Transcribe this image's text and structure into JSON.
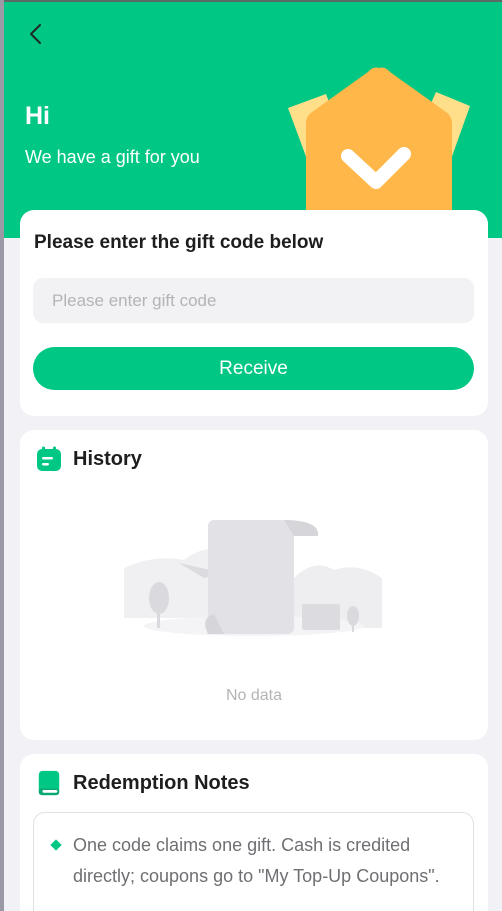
{
  "header": {
    "back_icon": "chevron-left-icon",
    "greeting": "Hi",
    "subtitle": "We have a gift for you",
    "illustration": "crown-badge-check"
  },
  "gift_card": {
    "title": "Please enter the gift code below",
    "input_placeholder": "Please enter gift code",
    "input_value": "",
    "receive_label": "Receive"
  },
  "history": {
    "icon": "calendar-list-icon",
    "title": "History",
    "empty_illustration": "empty-scroll",
    "empty_text": "No data"
  },
  "notes": {
    "icon": "book-icon",
    "title": "Redemption Notes",
    "items": [
      "One code claims one gift. Cash is credited directly; coupons go to \"My Top-Up Coupons\"."
    ]
  },
  "colors": {
    "brand_green": "#00c784",
    "crown_orange": "#ffb74a",
    "crown_light": "#ffdf8a",
    "page_bg": "#f2f2f6",
    "muted_text": "#b4b4b8"
  }
}
